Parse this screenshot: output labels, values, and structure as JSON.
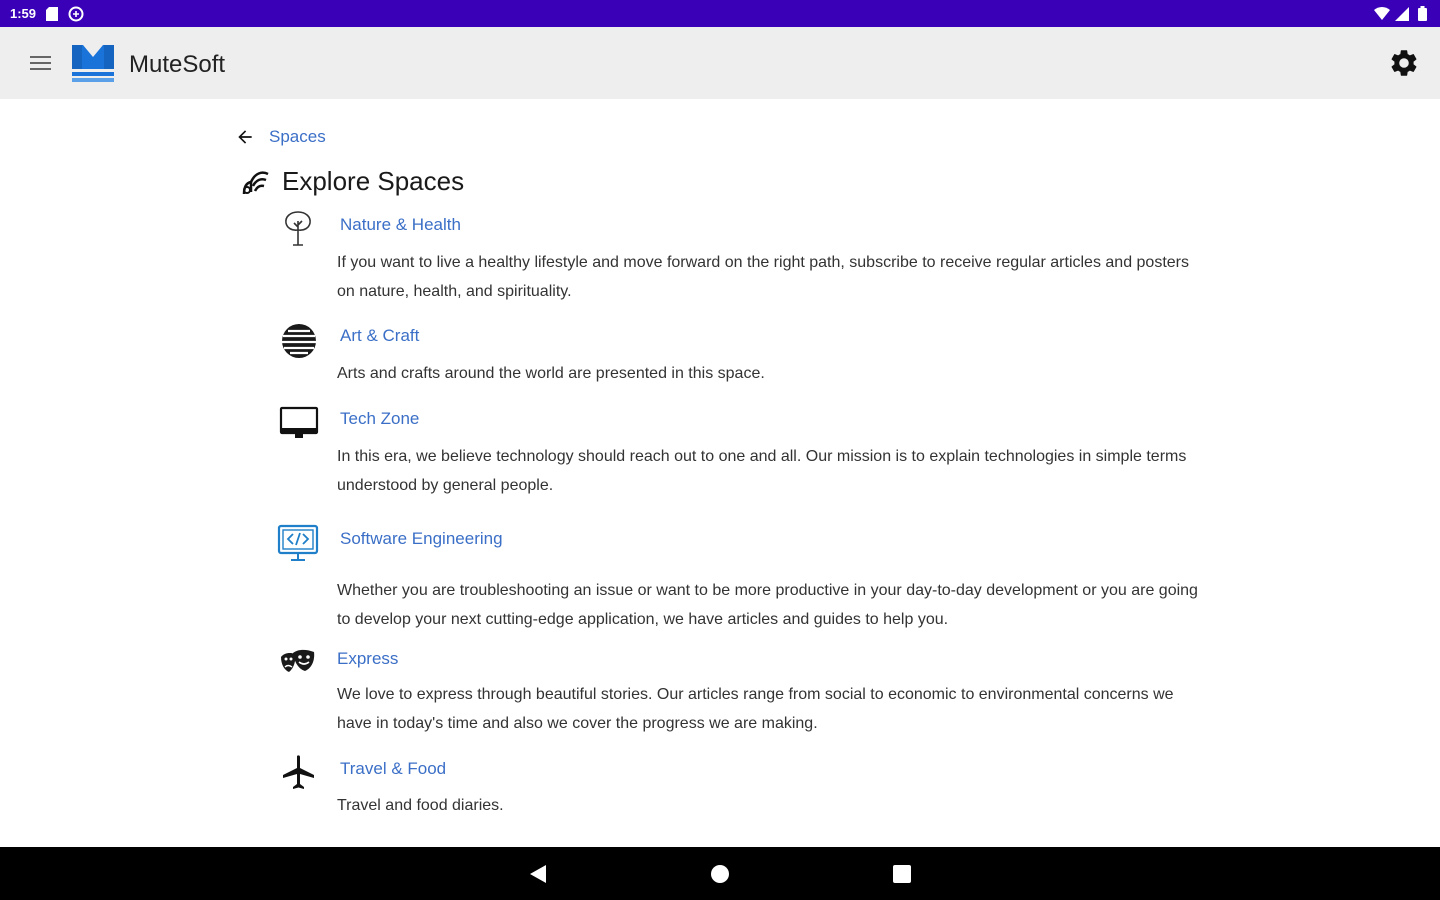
{
  "status_bar": {
    "time": "1:59"
  },
  "app_bar": {
    "title": "MuteSoft",
    "brand_color": "#1565c0"
  },
  "breadcrumb": {
    "label": "Spaces"
  },
  "page": {
    "title": "Explore Spaces"
  },
  "spaces": [
    {
      "name": "Nature & Health",
      "icon": "tree-icon",
      "description": "If you want to live a healthy lifestyle and move forward on the right path, subscribe to receive regular articles and posters on nature, health, and spirituality."
    },
    {
      "name": "Art & Craft",
      "icon": "globe-icon",
      "description": "Arts and crafts around the world are presented in this space."
    },
    {
      "name": "Tech Zone",
      "icon": "monitor-icon",
      "description": "In this era, we believe technology should reach out to one and all. Our mission is to explain technologies in simple terms understood by general people."
    },
    {
      "name": "Software Engineering",
      "icon": "code-monitor-icon",
      "description": "Whether you are troubleshooting an issue or want to be more productive in your day-to-day development or you are going to develop your next cutting-edge application, we have articles and guides to help you."
    },
    {
      "name": "Express",
      "icon": "theater-masks-icon",
      "description": "We love to express through beautiful stories. Our articles range from social to economic to environmental concerns we have in today's time and also we cover the progress we are making."
    },
    {
      "name": "Travel & Food",
      "icon": "airplane-icon",
      "description": "Travel and food diaries."
    }
  ],
  "colors": {
    "status_bar": "#3a00b8",
    "link": "#3b6fc7",
    "app_bar": "#eeeeee"
  }
}
